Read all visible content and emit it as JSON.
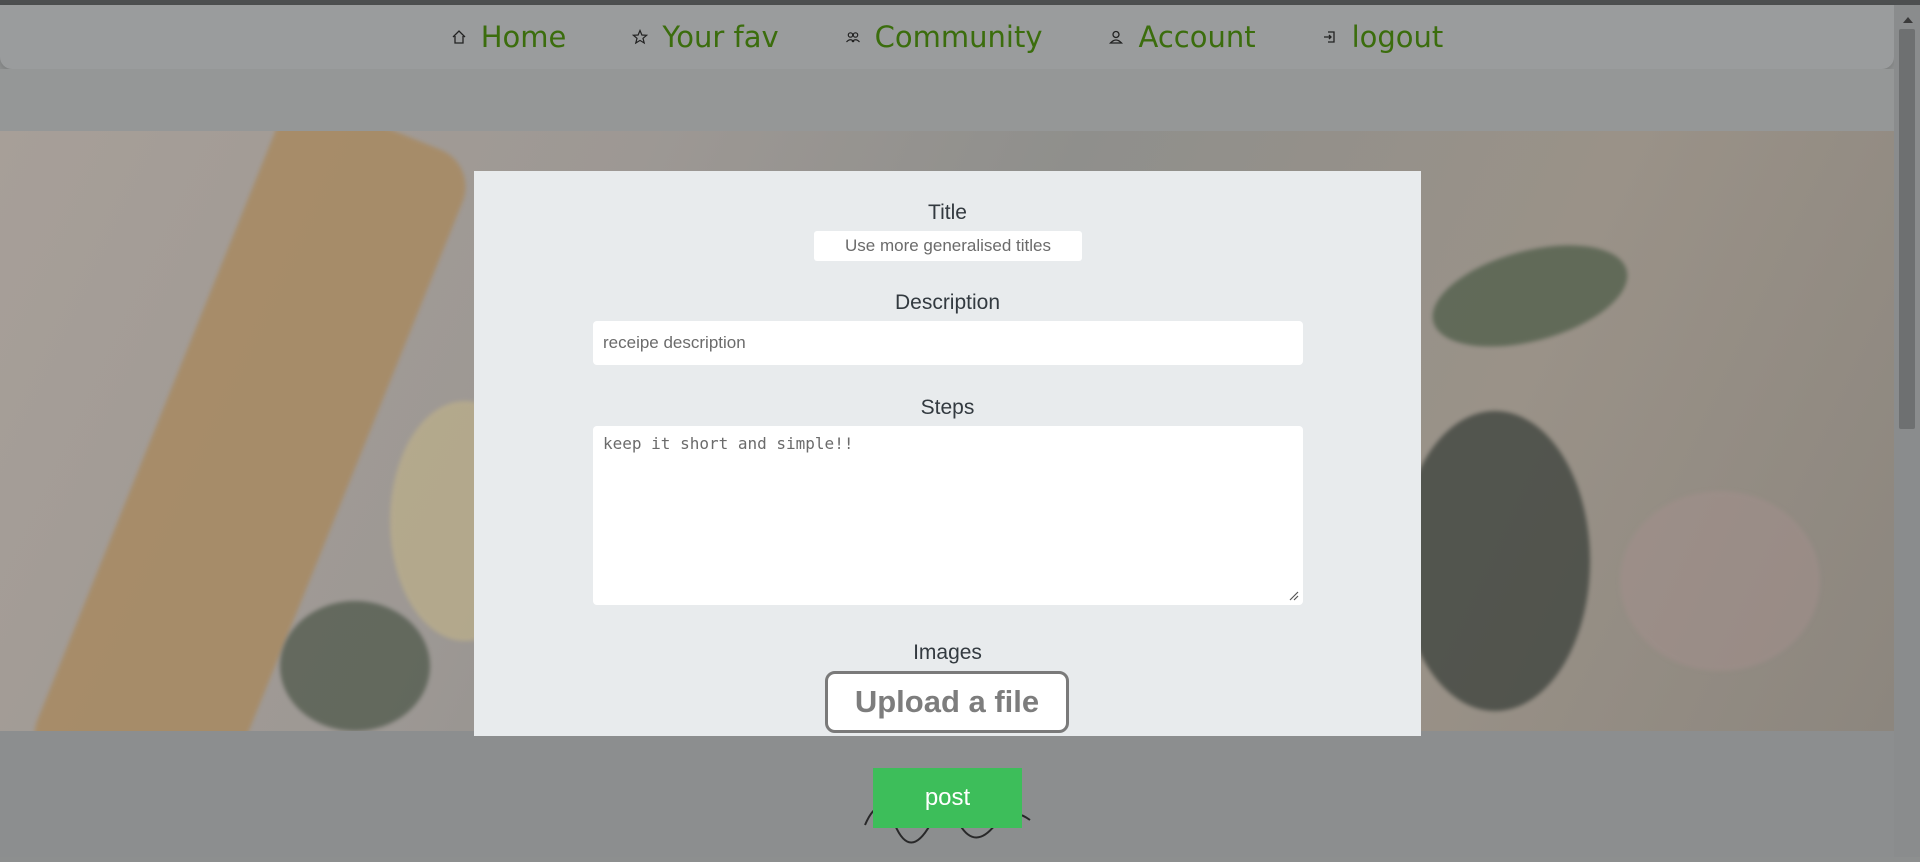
{
  "nav": {
    "items": [
      {
        "label": "Home",
        "icon": "home-icon"
      },
      {
        "label": "Your fav",
        "icon": "star-icon"
      },
      {
        "label": "Community",
        "icon": "community-icon"
      },
      {
        "label": "Account",
        "icon": "user-icon"
      },
      {
        "label": "logout",
        "icon": "logout-icon"
      }
    ],
    "link_color": "#3b6d0d"
  },
  "form": {
    "title_label": "Title",
    "title_placeholder": "Use more generalised titles",
    "description_label": "Description",
    "description_placeholder": "receipe description",
    "steps_label": "Steps",
    "steps_placeholder": "keep it short and simple!!",
    "images_label": "Images",
    "upload_label": "Upload a file",
    "post_label": "post"
  },
  "colors": {
    "modal_background": "#e8ebed",
    "post_button": "#3dbe5a",
    "overlay": "#8d8f8f"
  }
}
